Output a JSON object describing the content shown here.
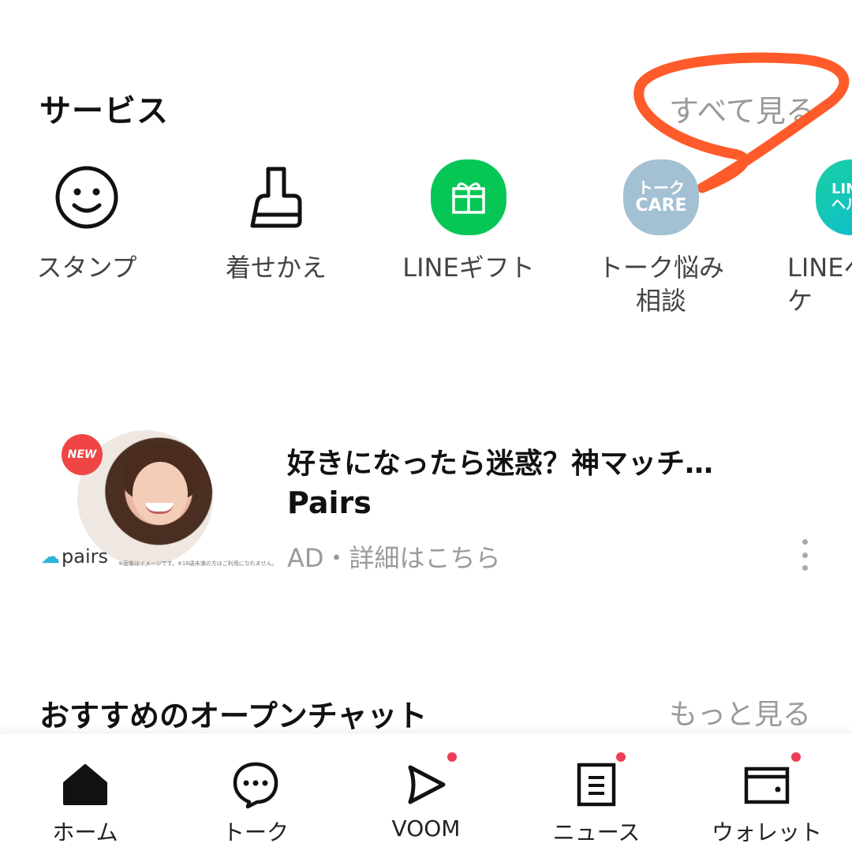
{
  "services": {
    "title": "サービス",
    "see_all": "すべて見る",
    "items": [
      {
        "label": "スタンプ",
        "icon": "smiley-icon"
      },
      {
        "label": "着せかえ",
        "icon": "brush-icon"
      },
      {
        "label": "LINEギフト",
        "icon": "gift-icon"
      },
      {
        "label": "トーク悩み\n相談",
        "icon": "talk-care-icon",
        "icon_text1": "トーク",
        "icon_text2": "CARE"
      },
      {
        "label": "LINEヘ\nケ",
        "icon": "line-health-icon",
        "icon_text1": "LIN",
        "icon_text2": "ヘルス"
      }
    ],
    "annotation_color": "#ff5a2a"
  },
  "ad": {
    "title": "好きになったら迷惑？神マッチ…",
    "brand": "Pairs",
    "meta": "AD・詳細はこちら",
    "badge": "NEW",
    "logo_text": "pairs",
    "fine_print": "※画像はイメージです。※18歳未満の方はご利用になれません。"
  },
  "open_chat": {
    "title": "おすすめのオープンチャット",
    "more": "もっと見る"
  },
  "bottom_nav": {
    "items": [
      {
        "label": "ホーム",
        "icon": "home-icon",
        "badge": false,
        "active": true
      },
      {
        "label": "トーク",
        "icon": "chat-icon",
        "badge": false
      },
      {
        "label": "VOOM",
        "icon": "voom-icon",
        "badge": true
      },
      {
        "label": "ニュース",
        "icon": "news-icon",
        "badge": true
      },
      {
        "label": "ウォレット",
        "icon": "wallet-icon",
        "badge": true
      }
    ],
    "badge_color": "#f03c57"
  }
}
